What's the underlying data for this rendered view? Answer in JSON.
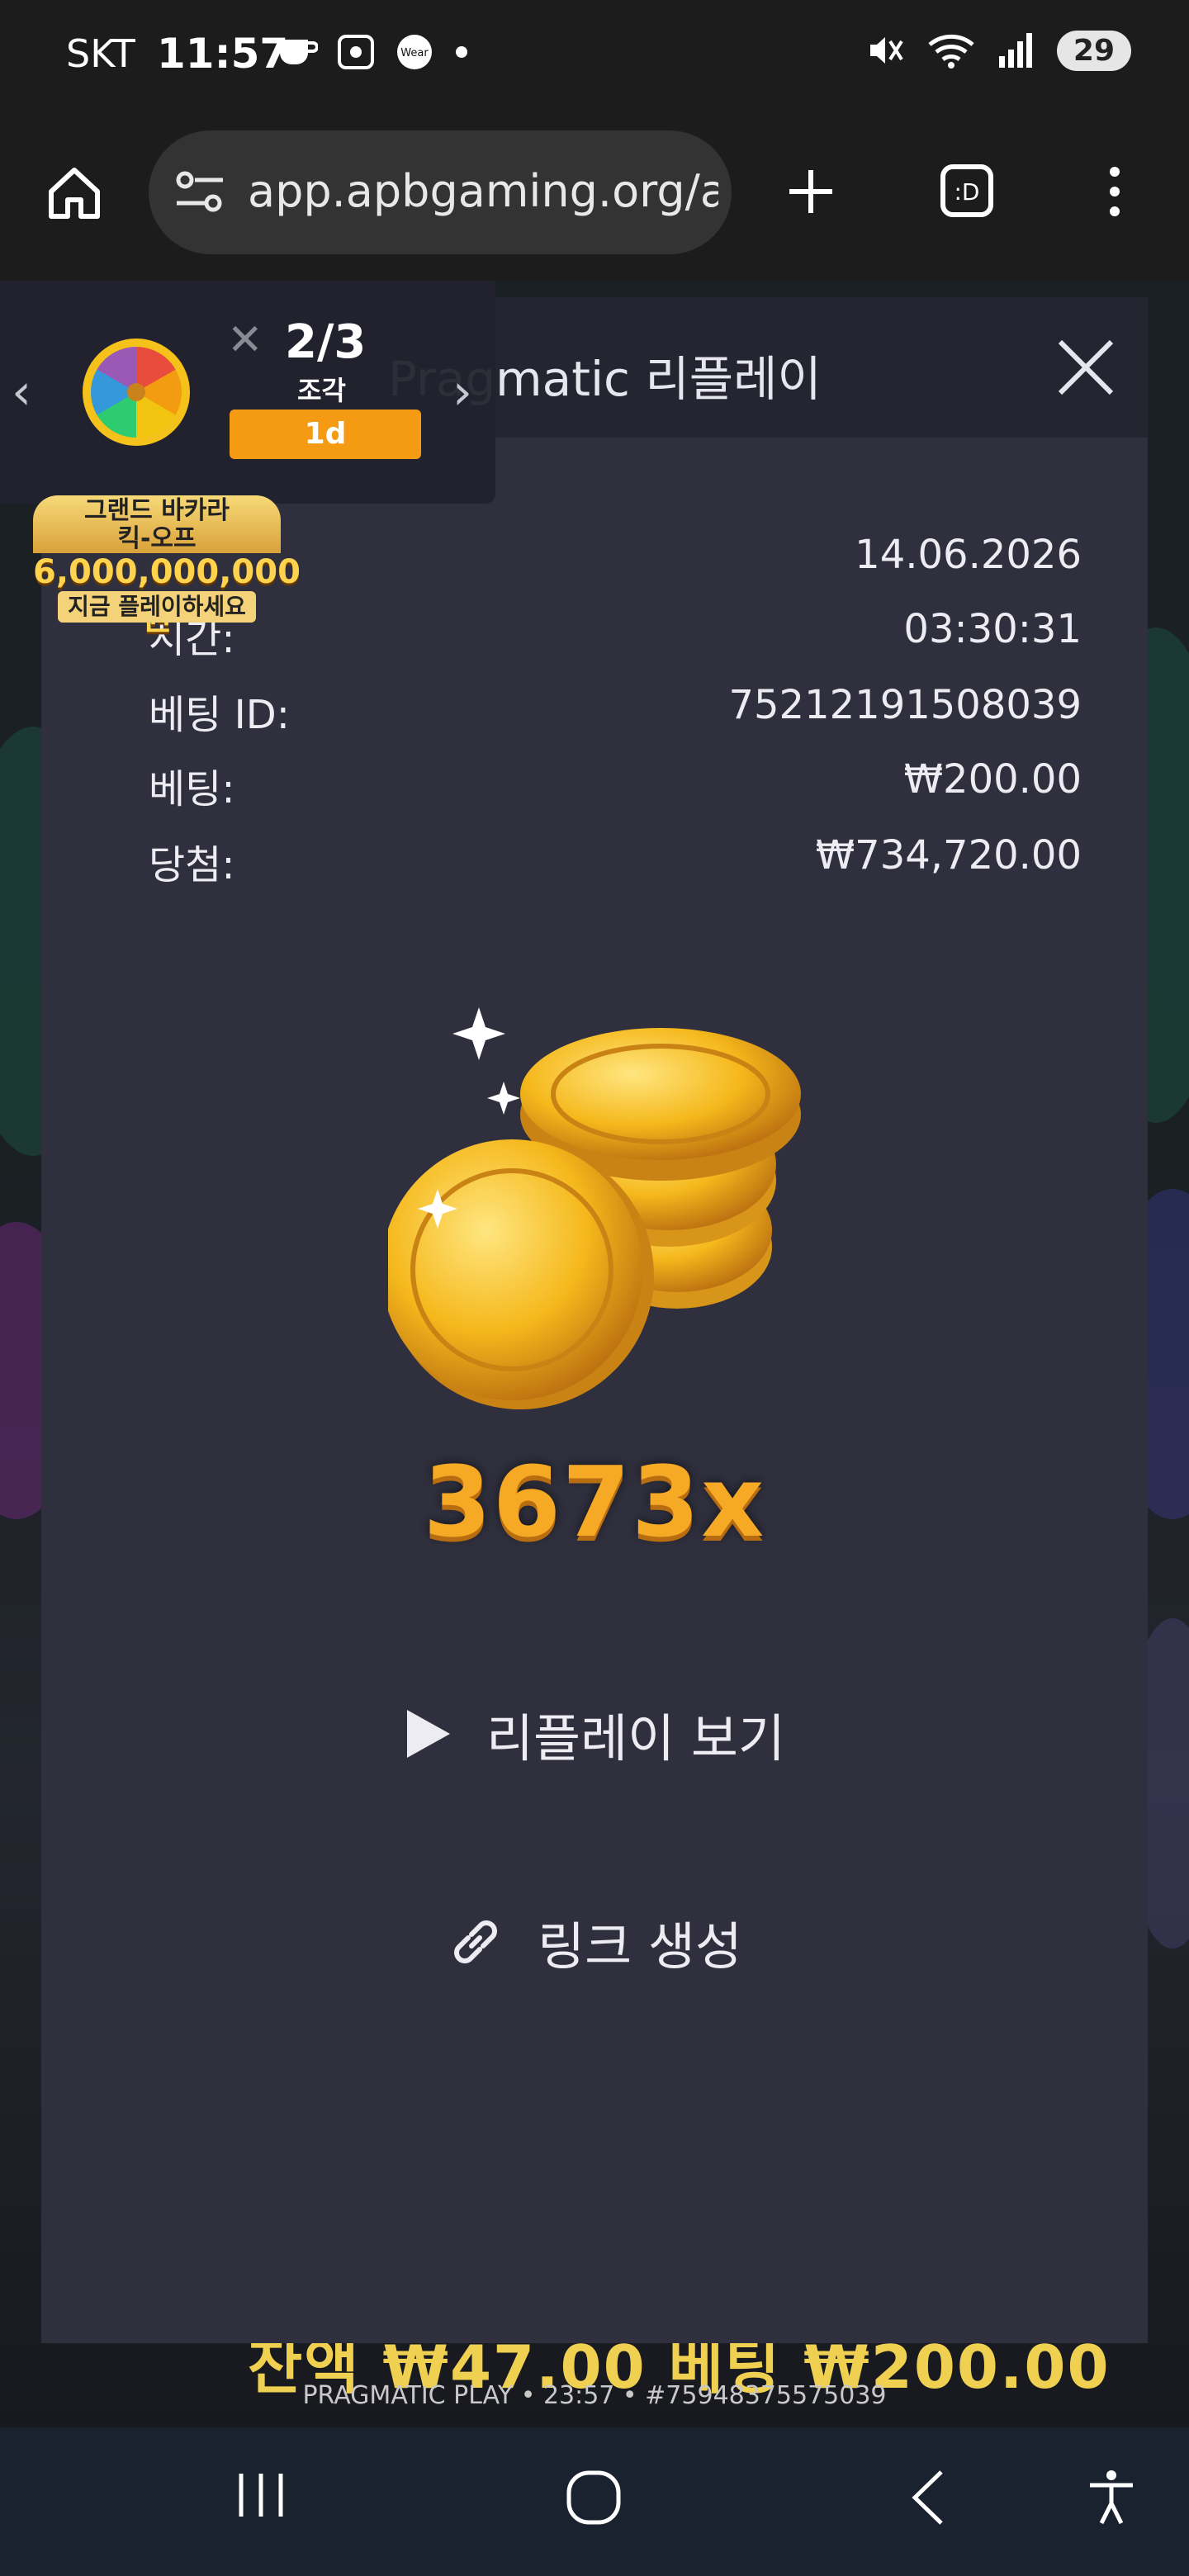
{
  "status_bar": {
    "carrier": "SKT",
    "time": "11:57",
    "battery": "29"
  },
  "browser": {
    "url": "app.apbgaming.org/ap"
  },
  "promo": {
    "count": "2/3",
    "sub_label": "조각",
    "badge": "1d"
  },
  "banner": {
    "line1": "그랜드 바카라\n킥-오프",
    "amount": "6,000,000,000원",
    "cta": "지금 플레이하세요"
  },
  "modal": {
    "title": "Pragmatic 리플레이",
    "rows": [
      {
        "label": "",
        "value": "14.06.2026"
      },
      {
        "label": "시간:",
        "value": "03:30:31"
      },
      {
        "label": "베팅 ID:",
        "value": "75212191508039"
      },
      {
        "label": "베팅:",
        "value": "₩200.00"
      },
      {
        "label": "당첨:",
        "value": "₩734,720.00"
      }
    ],
    "multiplier": "3673x",
    "replay_label": "리플레이 보기",
    "link_label": "링크 생성"
  },
  "background": {
    "footer_text": "잔액 ₩47.00   베팅 ₩200.00",
    "footer_meta": "PRAGMATIC PLAY • 23:57 • #75948375575039"
  },
  "colors": {
    "modal_bg": "#2f2f3d",
    "header_bg": "#252431",
    "multiplier": "#f5a924",
    "badge": "#f59b13"
  }
}
